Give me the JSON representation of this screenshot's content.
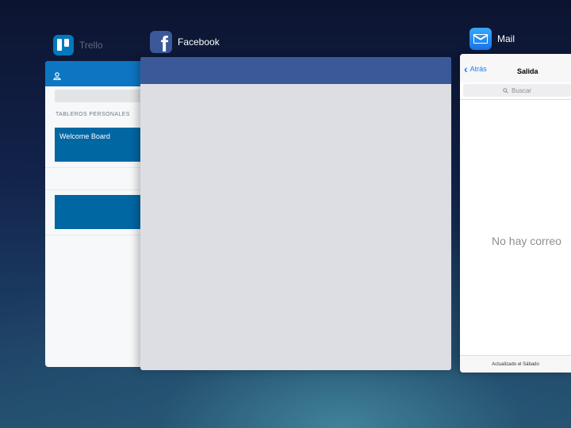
{
  "apps": {
    "trello": {
      "name": "Trello",
      "section_title": "TABLEROS PERSONALES",
      "boards": [
        "Welcome Board",
        ""
      ],
      "accent": "#0079bf"
    },
    "facebook": {
      "name": "Facebook",
      "accent": "#3b5998"
    },
    "mail": {
      "name": "Mail",
      "back_label": "Atrás",
      "title": "Salida",
      "search_placeholder": "Buscar",
      "empty_message": "No hay correo",
      "footer_status": "Actualizado el Sábado",
      "accent": "#147efb"
    }
  }
}
